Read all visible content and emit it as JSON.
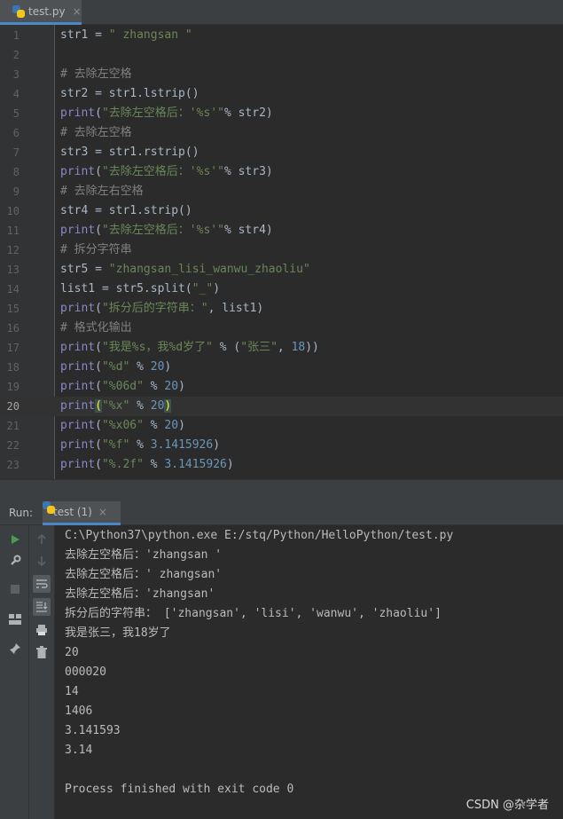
{
  "tab": {
    "filename": "test.py",
    "close": "×"
  },
  "editor": {
    "current_line": 20,
    "lines": [
      {
        "n": "1",
        "html": "str1 = <span class='str'>\" zhangsan \"</span>"
      },
      {
        "n": "2",
        "html": ""
      },
      {
        "n": "3",
        "html": "<span class='cmt'># 去除左空格</span>"
      },
      {
        "n": "4",
        "html": "str2 = str1.lstrip()"
      },
      {
        "n": "5",
        "html": "<span class='kw-fn'>print</span>(<span class='str'>\"去除左空格后：'%s'\"</span>% str2)"
      },
      {
        "n": "6",
        "html": "<span class='cmt'># 去除左空格</span>"
      },
      {
        "n": "7",
        "html": "str3 = str1.rstrip()"
      },
      {
        "n": "8",
        "html": "<span class='kw-fn'>print</span>(<span class='str'>\"去除左空格后：'%s'\"</span>% str3)"
      },
      {
        "n": "9",
        "html": "<span class='cmt'># 去除左右空格</span>"
      },
      {
        "n": "10",
        "html": "str4 = str1.strip()"
      },
      {
        "n": "11",
        "html": "<span class='kw-fn'>print</span>(<span class='str'>\"去除左空格后：'%s'\"</span>% str4)"
      },
      {
        "n": "12",
        "html": "<span class='cmt'># 拆分字符串</span>"
      },
      {
        "n": "13",
        "html": "str5 = <span class='str'>\"zhangsan_lisi_wanwu_zhaoliu\"</span>"
      },
      {
        "n": "14",
        "html": "list1 = str5.split(<span class='str'>\"_\"</span>)"
      },
      {
        "n": "15",
        "html": "<span class='kw-fn'>print</span>(<span class='str'>\"拆分后的字符串：\"</span>, list1)"
      },
      {
        "n": "16",
        "html": "<span class='cmt'># 格式化输出</span>"
      },
      {
        "n": "17",
        "html": "<span class='kw-fn'>print</span>(<span class='str'>\"我是%s，我%d岁了\"</span> % (<span class='str'>\"张三\"</span>, <span class='num'>18</span>))"
      },
      {
        "n": "18",
        "html": "<span class='kw-fn'>print</span>(<span class='str'>\"%d\"</span> % <span class='num'>20</span>)"
      },
      {
        "n": "19",
        "html": "<span class='kw-fn'>print</span>(<span class='str'>\"%06d\"</span> % <span class='num'>20</span>)"
      },
      {
        "n": "20",
        "html": "<span class='kw-fn'>print</span><span class='brace'>(</span><span class='str'>\"%x\"</span> % <span class='num'>20</span><span class='brace'>)</span>"
      },
      {
        "n": "21",
        "html": "<span class='kw-fn'>print</span>(<span class='str'>\"%x06\"</span> % <span class='num'>20</span>)"
      },
      {
        "n": "22",
        "html": "<span class='kw-fn'>print</span>(<span class='str'>\"%f\"</span> % <span class='num'>3.1415926</span>)"
      },
      {
        "n": "23",
        "html": "<span class='kw-fn'>print</span>(<span class='str'>\"%.2f\"</span> % <span class='num'>3.1415926</span>)"
      }
    ]
  },
  "run": {
    "label": "Run:",
    "tab_label": "test (1)",
    "close": "×",
    "output": [
      "C:\\Python37\\python.exe E:/stq/Python/HelloPython/test.py",
      "去除左空格后：'zhangsan '",
      "去除左空格后：' zhangsan'",
      "去除左空格后：'zhangsan'",
      "拆分后的字符串： ['zhangsan', 'lisi', 'wanwu', 'zhaoliu']",
      "我是张三，我18岁了",
      "20",
      "000020",
      "14",
      "1406",
      "3.141593",
      "3.14",
      "",
      "Process finished with exit code 0"
    ]
  },
  "watermark": "CSDN @杂学者",
  "colors": {
    "accent": "#4a88c7",
    "run_green": "#499c54",
    "string": "#6a8759",
    "number": "#6897bb",
    "comment": "#808080",
    "builtin": "#8888c6"
  }
}
